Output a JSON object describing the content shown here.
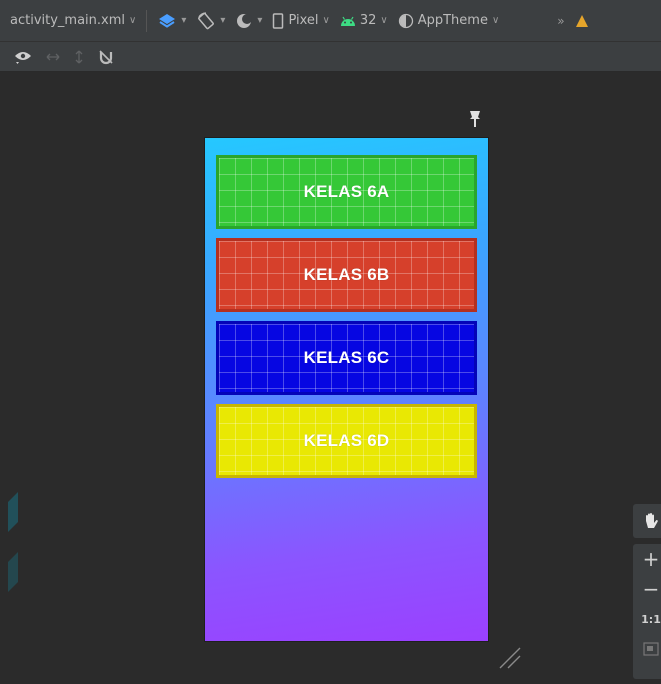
{
  "toolbar": {
    "file_name": "activity_main.xml",
    "device": "Pixel",
    "api_level": "32",
    "theme": "AppTheme",
    "overflow": "»"
  },
  "preview": {
    "buttons": [
      {
        "label": "KELAS 6A",
        "color": "#35c837",
        "border": "#2aa52c"
      },
      {
        "label": "KELAS 6B",
        "color": "#d6402b",
        "border": "#b43020"
      },
      {
        "label": "KELAS 6C",
        "color": "#0606e2",
        "border": "#0404b8"
      },
      {
        "label": "KELAS 6D",
        "color": "#e9e803",
        "border": "#c8b600"
      }
    ],
    "gradient_colors": [
      "#25c8ff",
      "#9b40ff"
    ]
  },
  "zoom": {
    "plus": "+",
    "minus": "−",
    "reset": "1:1"
  },
  "colors": {
    "toolbar_bg": "#3c3f41",
    "canvas_bg": "#2b2b2b",
    "accent_blue": "#4a9eff",
    "android_green": "#3ddc84"
  }
}
